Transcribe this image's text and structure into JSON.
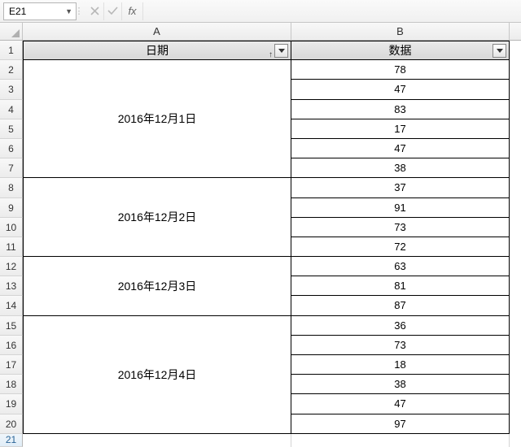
{
  "formula_bar": {
    "namebox": "E21",
    "fx_label": "fx",
    "formula_value": ""
  },
  "columns": {
    "A": "A",
    "B": "B"
  },
  "headers": {
    "date": "日期",
    "data": "数据"
  },
  "groups": [
    {
      "label": "2016年12月1日",
      "values": [
        78,
        47,
        83,
        17,
        47,
        38
      ]
    },
    {
      "label": "2016年12月2日",
      "values": [
        37,
        91,
        73,
        72
      ]
    },
    {
      "label": "2016年12月3日",
      "values": [
        63,
        81,
        87
      ]
    },
    {
      "label": "2016年12月4日",
      "values": [
        36,
        73,
        18,
        38,
        47,
        97
      ]
    }
  ],
  "row_count_displayed": 21
}
